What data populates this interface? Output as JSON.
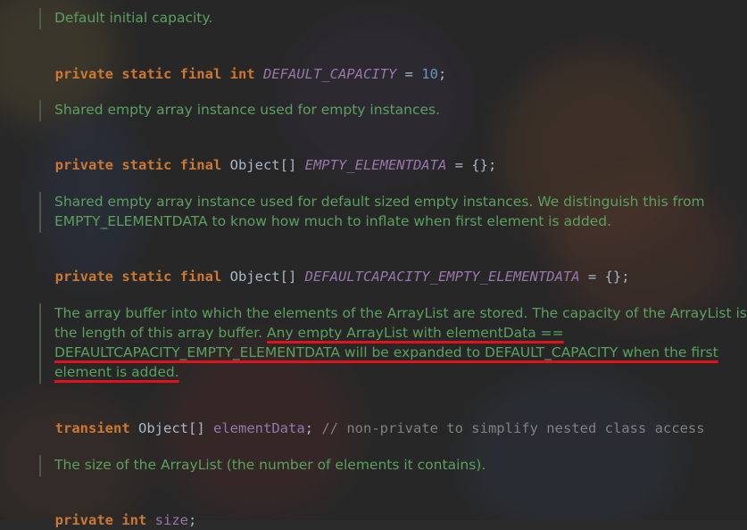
{
  "docs": {
    "default_capacity": "Default initial capacity.",
    "empty_elementdata": "Shared empty array instance used for empty instances.",
    "defaultcapacity_empty_line1": "Shared empty array instance used for default sized empty instances. We distinguish this from",
    "defaultcapacity_empty_line2": "EMPTY_ELEMENTDATA to know how much to inflate when first element is added.",
    "elementdata_line1": "The array buffer into which the elements of the ArrayList are stored. The capacity of the ArrayList is",
    "elementdata_line2_plain": "the length of this array buffer. ",
    "elementdata_line2_underlined": "Any empty ArrayList with elementData ==",
    "elementdata_line3": "DEFAULTCAPACITY_EMPTY_ELEMENTDATA will be expanded to DEFAULT_CAPACITY when the first",
    "elementdata_line4": "element is added.",
    "size": "The size of the ArrayList (the number of elements it contains)."
  },
  "code": {
    "line1": {
      "mods": "private static final int",
      "name": "DEFAULT_CAPACITY",
      "rest": " = ",
      "value": "10",
      "end": ";"
    },
    "line2": {
      "mods": "private static final",
      "type": " Object[] ",
      "name": "EMPTY_ELEMENTDATA",
      "rest": " = {};"
    },
    "line3": {
      "mods": "private static final",
      "type": " Object[] ",
      "name": "DEFAULTCAPACITY_EMPTY_ELEMENTDATA",
      "rest": " = {};"
    },
    "line4": {
      "mods": "transient",
      "type": " Object[] ",
      "name": "elementData",
      "rest": "; ",
      "comment": "// non-private to simplify nested class access"
    },
    "line5": {
      "mods": "private int",
      "name": "size",
      "rest": ";"
    }
  },
  "colors": {
    "background": "#2b2b2b",
    "keyword": "#cc7832",
    "constant": "#9876aa",
    "number": "#6897bb",
    "doc_comment": "#5ba05e",
    "line_comment": "#808080",
    "annotation_underline": "#e0121b"
  }
}
